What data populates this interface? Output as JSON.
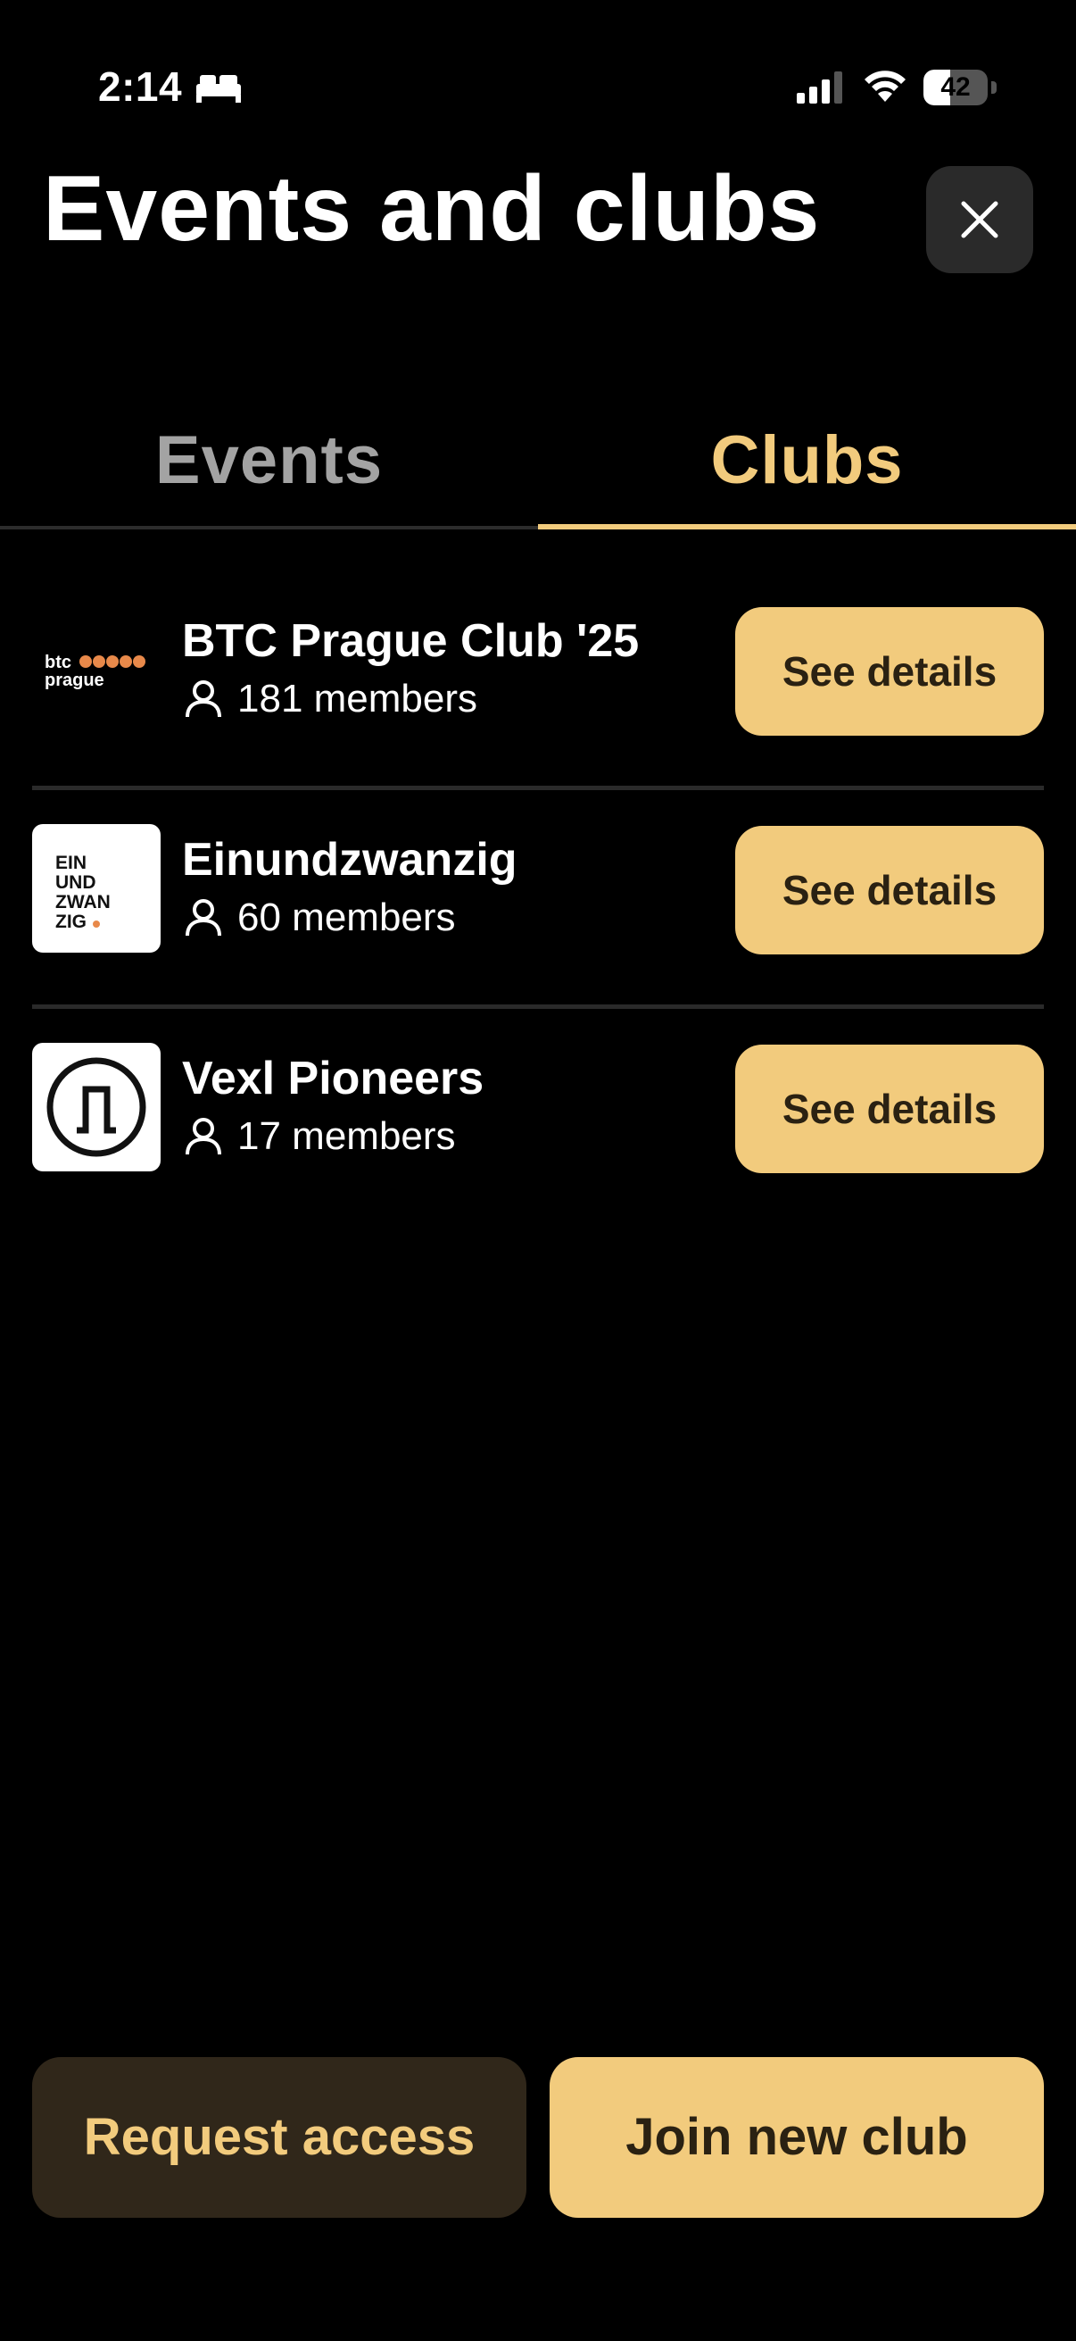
{
  "status_bar": {
    "time": "2:14",
    "battery_level": "42",
    "battery_fraction": 0.42
  },
  "header": {
    "title": "Events and clubs",
    "close_icon": "close-icon"
  },
  "tabs": [
    {
      "label": "Events",
      "active": false
    },
    {
      "label": "Clubs",
      "active": true
    }
  ],
  "clubs": [
    {
      "name": "BTC Prague Club '25",
      "members": "181 members",
      "button_label": "See details",
      "logo_text": "btc prague"
    },
    {
      "name": "Einundzwanzig",
      "members": "60 members",
      "button_label": "See details",
      "logo_text": "EIN UND ZWAN ZIG"
    },
    {
      "name": "Vexl Pioneers",
      "members": "17 members",
      "button_label": "See details"
    }
  ],
  "actions": {
    "request_access": "Request access",
    "join_new_club": "Join new club"
  },
  "colors": {
    "accent": "#f2cb7d",
    "background": "#000000",
    "dark_button": "#30271a",
    "inactive_tab": "#a3a3a3"
  }
}
